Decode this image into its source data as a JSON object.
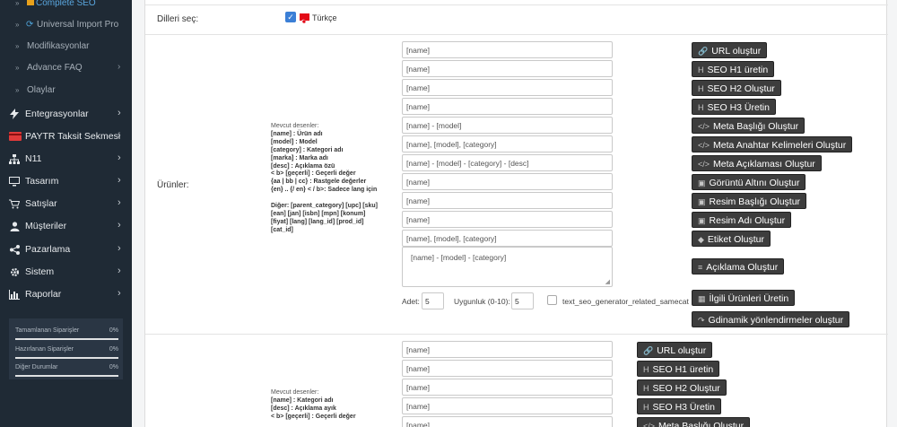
{
  "sidebar": {
    "subitems": [
      {
        "label": "Complete SEO",
        "chevron": ""
      },
      {
        "label": "Universal Import Pro",
        "chevron": ""
      },
      {
        "label": "Modifikasyonlar",
        "chevron": ""
      },
      {
        "label": "Advance FAQ",
        "chevron": "›"
      },
      {
        "label": "Olaylar",
        "chevron": ""
      }
    ],
    "nav": [
      {
        "label": "Entegrasyonlar",
        "icon": "bolt-icon",
        "chevron": "›"
      },
      {
        "label": "PAYTR Taksit Sekmesi",
        "icon": "credit-card-icon",
        "chevron": "›"
      },
      {
        "label": "N11",
        "icon": "sitemap-icon",
        "chevron": "›"
      },
      {
        "label": "Tasarım",
        "icon": "monitor-icon",
        "chevron": "›"
      },
      {
        "label": "Satışlar",
        "icon": "cart-icon",
        "chevron": "›"
      },
      {
        "label": "Müşteriler",
        "icon": "user-icon",
        "chevron": "›"
      },
      {
        "label": "Pazarlama",
        "icon": "share-icon",
        "chevron": "›"
      },
      {
        "label": "Sistem",
        "icon": "gear-icon",
        "chevron": "›"
      },
      {
        "label": "Raporlar",
        "icon": "bar-chart-icon",
        "chevron": "›"
      }
    ],
    "stats": [
      {
        "label": "Tamamlanan Siparişler",
        "pct": "0%",
        "value": 0
      },
      {
        "label": "Hazırlanan Siparişler",
        "pct": "0%",
        "value": 0
      },
      {
        "label": "Diğer Durumlar",
        "pct": "0%",
        "value": 0
      }
    ]
  },
  "lang": {
    "label": "Dilleri seç:",
    "language": "Türkçe",
    "checked": true
  },
  "products": {
    "label": "Ürünler:",
    "desc_title": "Mevcut desenler:",
    "desc_lines": [
      {
        "b": "[name] : Ürün adı"
      },
      {
        "b": "[model] : Model"
      },
      {
        "b": "[category] : Kategori adı"
      },
      {
        "b": "[marka] : Marka adı"
      },
      {
        "b": "[desc] : Açıklama özü"
      },
      {
        "b": "< b> [geçerli] : Geçerli değer"
      },
      {
        "b": "{aa | bb | cc} : Rastgele değerler"
      },
      {
        "b": "{en} .. {/ en} < / b>: Sadece lang için"
      },
      {
        "b": ""
      },
      {
        "b": "Diğer: [parent_category] [upc] [sku]"
      },
      {
        "b": "[ean] [jan] [isbn] [mpn] [konum]"
      },
      {
        "b": "[fiyat] [lang] [lang_id] [prod_id]"
      },
      {
        "b": "[cat_id]"
      }
    ],
    "fields": [
      {
        "value": "[name]",
        "button": "URL oluştur",
        "icon": "link-icon",
        "glyph": "🔗"
      },
      {
        "value": "[name]",
        "button": "SEO H1 üretin",
        "icon": "header-icon",
        "glyph": "H"
      },
      {
        "value": "[name]",
        "button": "SEO H2 Oluştur",
        "icon": "header-icon",
        "glyph": "H"
      },
      {
        "value": "[name]",
        "button": "SEO H3 Üretin",
        "icon": "header-icon",
        "glyph": "H"
      },
      {
        "value": "[name] - [model]",
        "button": "Meta Başlığı Oluştur",
        "icon": "code-icon",
        "glyph": "</>"
      },
      {
        "value": "[name], [model], [category]",
        "button": "Meta Anahtar Kelimeleri Oluştur",
        "icon": "code-icon",
        "glyph": "</>"
      },
      {
        "value": "[name] - [model] - [category] - [desc]",
        "button": "Meta Açıklaması Oluştur",
        "icon": "code-icon",
        "glyph": "</>"
      },
      {
        "value": "[name]",
        "button": "Görüntü Altını Oluştur",
        "icon": "image-icon",
        "glyph": "▣"
      },
      {
        "value": "[name]",
        "button": "Resim Başlığı Oluştur",
        "icon": "image-icon",
        "glyph": "▣"
      },
      {
        "value": "[name]",
        "button": "Resim Adı Oluştur",
        "icon": "image-icon",
        "glyph": "▣"
      },
      {
        "value": "[name], [model], [category]",
        "button": "Etiket Oluştur",
        "icon": "tag-icon",
        "glyph": "◆"
      }
    ],
    "textarea": {
      "value": "[name] - [model] - [category]",
      "button": "Açıklama Oluştur",
      "glyph": "≡"
    },
    "adet_label": "Adet:",
    "adet_value": "5",
    "uyg_label": "Uygunluk (0-10):",
    "uyg_value": "5",
    "checkbox_label": "text_seo_generator_related_samecat",
    "related_button": "İlgili Ürünleri Üretin",
    "related_glyph": "▦",
    "redirect_button": "Gdinamik yönlendirmeler oluştur",
    "redirect_glyph": "↷"
  },
  "categories": {
    "desc_title": "Mevcut desenler:",
    "desc_lines": [
      {
        "b": "[name] : Kategori adı"
      },
      {
        "b": "[desc] : Açıklama ayık"
      },
      {
        "b": "< b> [geçerli] : Geçerli değer"
      }
    ],
    "fields": [
      {
        "value": "[name]",
        "button": "URL oluştur",
        "glyph": "🔗"
      },
      {
        "value": "[name]",
        "button": "SEO H1 üretin",
        "glyph": "H"
      },
      {
        "value": "[name]",
        "button": "SEO H2 Oluştur",
        "glyph": "H"
      },
      {
        "value": "[name]",
        "button": "SEO H3 Üretin",
        "glyph": "H"
      },
      {
        "value": "[name]",
        "button": "Meta Başlığı Oluştur",
        "glyph": "</>"
      }
    ]
  }
}
